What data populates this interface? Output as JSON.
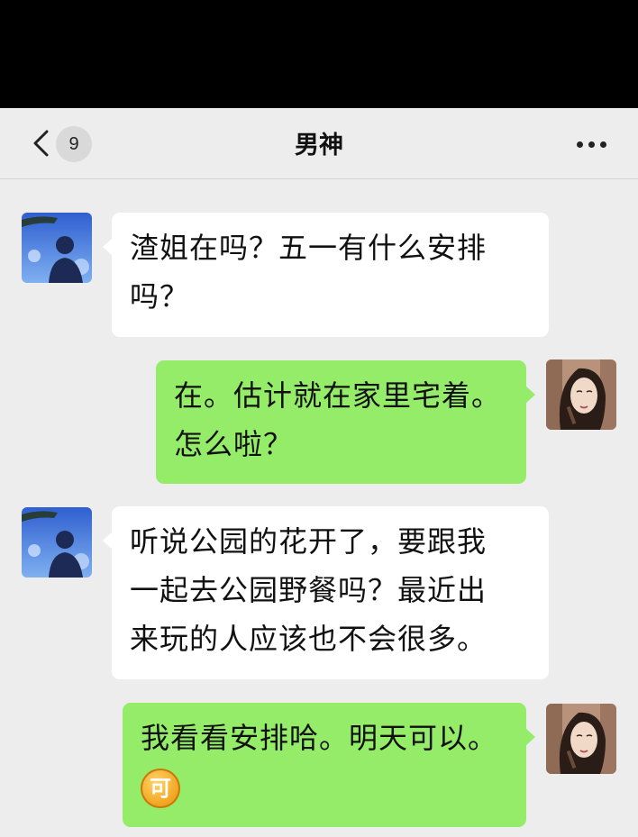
{
  "header": {
    "back_icon": "chevron-left-icon",
    "unread_count": "9",
    "title": "男神",
    "more_icon": "more-dots-icon"
  },
  "messages": [
    {
      "sender": "left",
      "avatar": "male-silhouette-avatar",
      "lines": [
        "渣姐在吗？五一有什么安排",
        "吗？"
      ]
    },
    {
      "sender": "right",
      "avatar": "female-portrait-avatar",
      "lines": [
        "在。估计就在家里宅着。",
        "怎么啦？"
      ]
    },
    {
      "sender": "left",
      "avatar": "male-silhouette-avatar",
      "lines": [
        "听说公园的花开了，要跟我",
        "一起去公园野餐吗？最近出",
        "来玩的人应该也不会很多。"
      ]
    },
    {
      "sender": "right",
      "avatar": "female-portrait-avatar",
      "lines": [
        "我看看安排哈。明天可以。"
      ],
      "emoji_text": "可"
    }
  ],
  "colors": {
    "chat_background": "#ededed",
    "bubble_self": "#95ec69",
    "bubble_other": "#ffffff",
    "status_bar": "#000000"
  }
}
